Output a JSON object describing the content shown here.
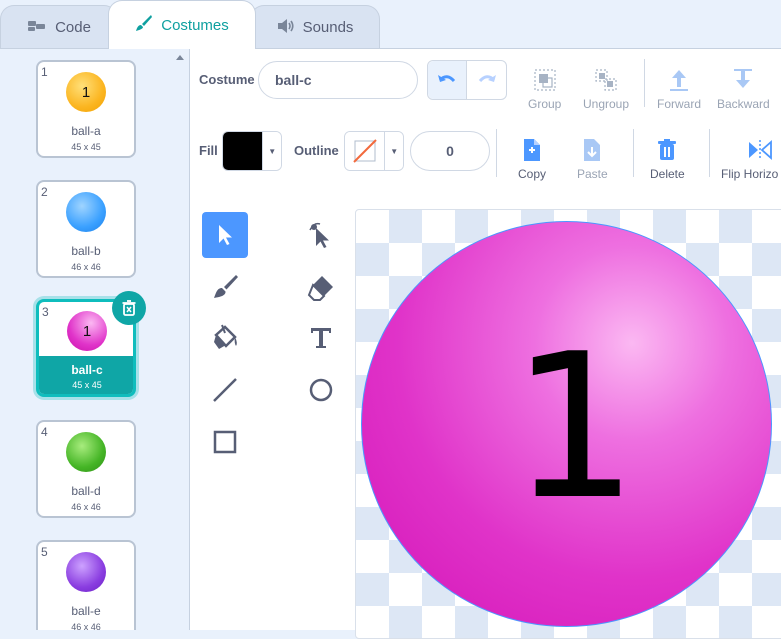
{
  "tabs": [
    {
      "label": "Code",
      "icon": "code-icon"
    },
    {
      "label": "Costumes",
      "icon": "brush-icon",
      "active": true
    },
    {
      "label": "Sounds",
      "icon": "speaker-icon"
    }
  ],
  "costumes": [
    {
      "index": "1",
      "name": "ball-a",
      "size": "45 x 45",
      "color": "#fbb520",
      "label": "1"
    },
    {
      "index": "2",
      "name": "ball-b",
      "size": "46 x 46",
      "color": "#3aa0ff",
      "label": ""
    },
    {
      "index": "3",
      "name": "ball-c",
      "size": "45 x 45",
      "color": "#e033c9",
      "label": "1",
      "selected": true
    },
    {
      "index": "4",
      "name": "ball-d",
      "size": "46 x 46",
      "color": "#45b526",
      "label": ""
    },
    {
      "index": "5",
      "name": "ball-e",
      "size": "46 x 46",
      "color": "#8a3de0",
      "label": ""
    }
  ],
  "editor": {
    "costume_label": "Costume",
    "costume_name": "ball-c",
    "group_label": "Group",
    "ungroup_label": "Ungroup",
    "forward_label": "Forward",
    "backward_label": "Backward",
    "fill_label": "Fill",
    "fill_color": "#000000",
    "outline_label": "Outline",
    "outline_width": "0",
    "copy_label": "Copy",
    "paste_label": "Paste",
    "delete_label": "Delete",
    "flip_label": "Flip Horizo"
  },
  "canvas": {
    "ball_text": "1",
    "ball_color": "#e033c9"
  },
  "accent": "#4c97ff",
  "teal": "#0fa6a6"
}
